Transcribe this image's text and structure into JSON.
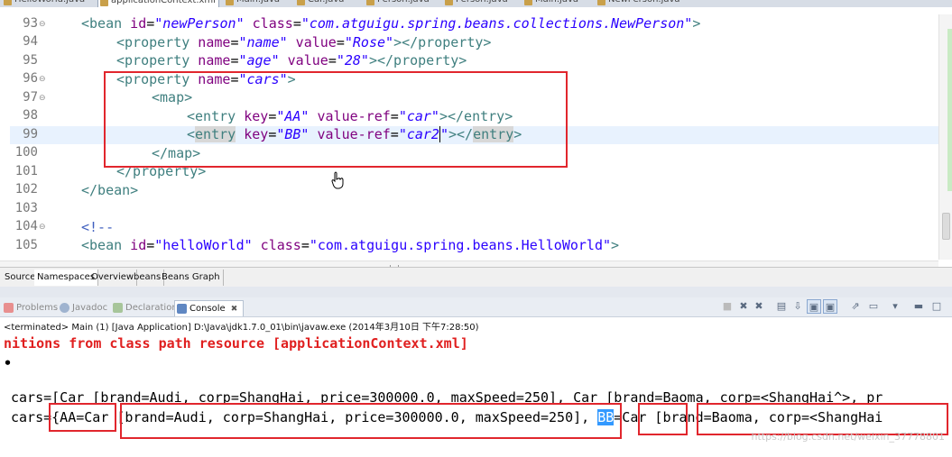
{
  "file_tabs": [
    "HelloWorld.java",
    "applicationContext.xml",
    "Main.java",
    "Car.java",
    "Person.java",
    "Person.java",
    "Main.java",
    "NewPerson.java"
  ],
  "editor": {
    "line_numbers": [
      "93",
      "94",
      "95",
      "96",
      "97",
      "98",
      "99",
      "100",
      "101",
      "102",
      "103",
      "104",
      "105"
    ],
    "fold_markers": {
      "93": "⊖",
      "96": "⊖",
      "97": "⊖",
      "104": "⊖"
    },
    "l93": {
      "tag": "<bean",
      "a1": " id",
      "v1": "\"newPerson\"",
      "a2": " class",
      "v2": "\"com.atguigu.spring.beans.collections.NewPerson\"",
      "end": ">"
    },
    "l94": {
      "tag": "<property",
      "a1": " name",
      "v1": "\"name\"",
      "a2": " value",
      "v2": "\"Rose\"",
      "end": "></property>"
    },
    "l95": {
      "tag": "<property",
      "a1": " name",
      "v1": "\"age\"",
      "a2": " value",
      "v2": "\"28\"",
      "end": "></property>"
    },
    "l96": {
      "tag": "<property",
      "a1": " name",
      "v1": "\"cars\"",
      "end": ">"
    },
    "l97": {
      "tag": "<map>"
    },
    "l98": {
      "tag": "<entry",
      "a1": " key",
      "v1": "\"AA\"",
      "a2": " value-ref",
      "v2": "\"car\"",
      "end": "></entry>"
    },
    "l99": {
      "lt": "<",
      "tag": "entry",
      "a1": " key",
      "v1": "\"BB\"",
      "a2": " value-ref",
      "v2a": "\"car2",
      "v2b": "\"",
      "end1": "></",
      "end2": "entry",
      "end3": ">"
    },
    "l100": {
      "tag": "</map>"
    },
    "l101": {
      "tag": "</property>"
    },
    "l102": {
      "tag": "</bean>"
    },
    "l104": {
      "comment": "<!--"
    },
    "l105": {
      "tag": "<bean",
      "a1": " id",
      "v1": "\"helloWorld\"",
      "a2": " class",
      "v2": "\"com.atguigu.spring.beans.HelloWorld\"",
      "end": ">"
    }
  },
  "editor_tabs": [
    "Source",
    "Namespaces",
    "Overview",
    "beans",
    "Beans Graph"
  ],
  "view_tabs": [
    {
      "label": "Problems",
      "icon": "problems-icon"
    },
    {
      "label": "Javadoc",
      "icon": "javadoc-icon"
    },
    {
      "label": "Declaration",
      "icon": "declaration-icon"
    },
    {
      "label": "Console",
      "icon": "console-icon",
      "close": "✖"
    }
  ],
  "console": {
    "terminated": "<terminated> Main (1) [Java Application] D:\\Java\\jdk1.7.0_01\\bin\\javaw.exe (2014年3月10日 下午7:28:50)",
    "line1": "nitions from class path resource [applicationContext.xml]",
    "line2": "•",
    "line3": "cars=[Car [brand=Audi, corp=ShangHai, price=300000.0, maxSpeed=250], Car [brand=Baoma, corp=<ShangHai^>, pr",
    "line4_a": "cars={AA=Car [brand=Audi, corp=ShangHai, price=300000.0, maxSpeed=250], ",
    "line4_sel": "BB",
    "line4_b": "=Car [brand=Baoma, corp=<ShangHai"
  },
  "watermark": "https://blog.csdn.net/weixin_37778801",
  "colors": {
    "highlight_box": "#e1262d",
    "tag": "#3f7f7f",
    "attr": "#7f007f",
    "value": "#2a00ff",
    "console_error": "#e01f1f"
  }
}
